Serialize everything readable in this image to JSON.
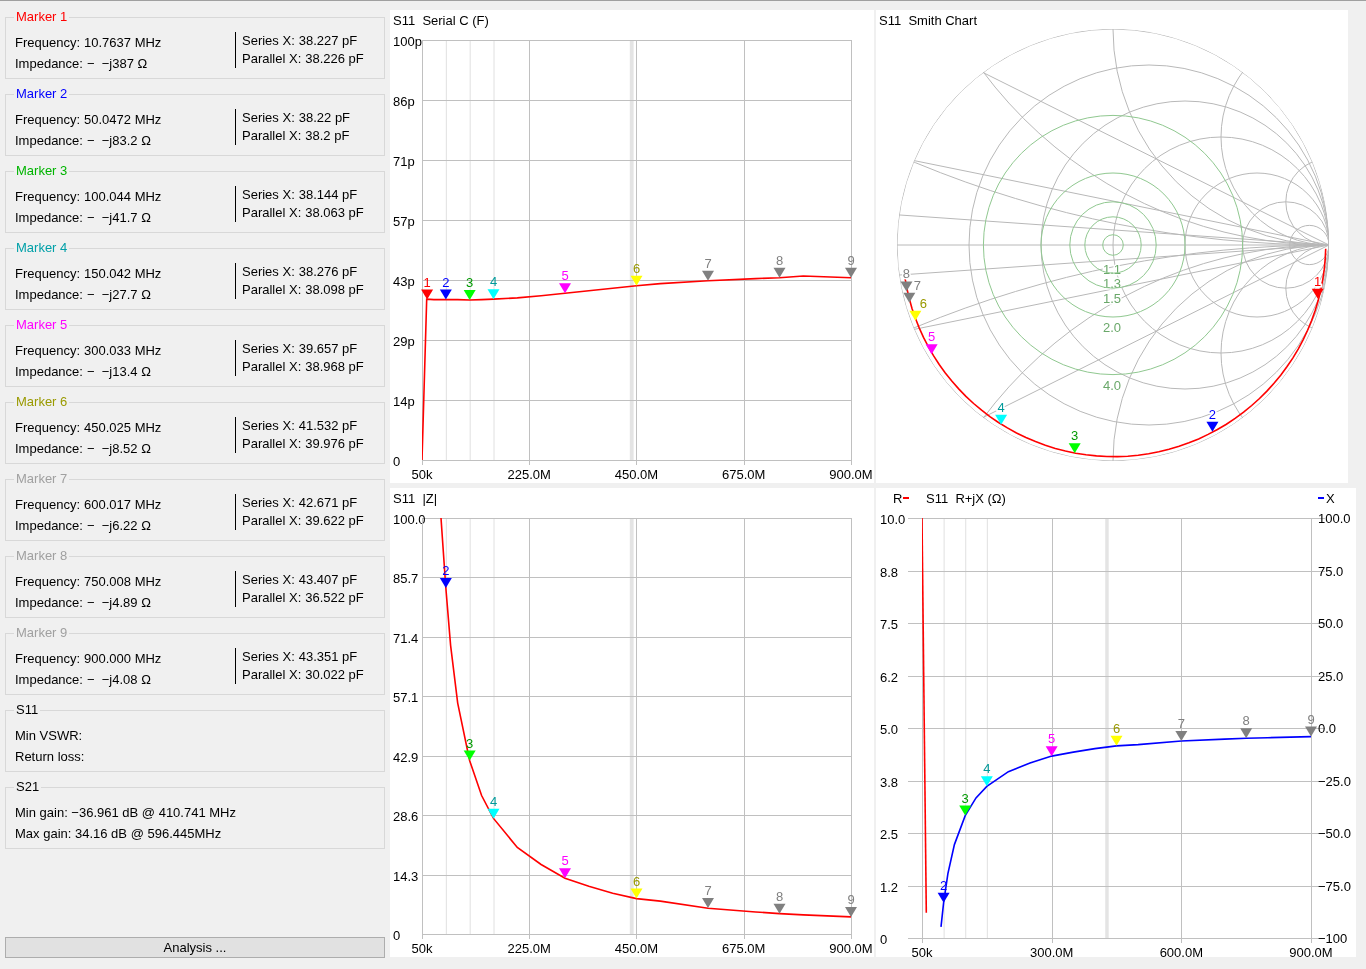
{
  "markers": [
    {
      "title": "Marker 1",
      "color": "#ff0000",
      "frequency_label": "Frequency:",
      "frequency": "10.7637 MHz",
      "impedance_label": "Impedance:",
      "impedance": "−  −j387 Ω",
      "series_label": "Series X:",
      "series_x": "38.227 pF",
      "parallel_label": "Parallel X:",
      "parallel_x": "38.226 pF"
    },
    {
      "title": "Marker 2",
      "color": "#0000ff",
      "frequency_label": "Frequency:",
      "frequency": "50.0472 MHz",
      "impedance_label": "Impedance:",
      "impedance": "−  −j83.2 Ω",
      "series_label": "Series X:",
      "series_x": "38.22 pF",
      "parallel_label": "Parallel X:",
      "parallel_x": "38.2 pF"
    },
    {
      "title": "Marker 3",
      "color": "#00b400",
      "frequency_label": "Frequency:",
      "frequency": "100.044 MHz",
      "impedance_label": "Impedance:",
      "impedance": "−  −j41.7 Ω",
      "series_label": "Series X:",
      "series_x": "38.144 pF",
      "parallel_label": "Parallel X:",
      "parallel_x": "38.063 pF"
    },
    {
      "title": "Marker 4",
      "color": "#00a0a8",
      "frequency_label": "Frequency:",
      "frequency": "150.042 MHz",
      "impedance_label": "Impedance:",
      "impedance": "−  −j27.7 Ω",
      "series_label": "Series X:",
      "series_x": "38.276 pF",
      "parallel_label": "Parallel X:",
      "parallel_x": "38.098 pF"
    },
    {
      "title": "Marker 5",
      "color": "#ff00ff",
      "frequency_label": "Frequency:",
      "frequency": "300.033 MHz",
      "impedance_label": "Impedance:",
      "impedance": "−  −j13.4 Ω",
      "series_label": "Series X:",
      "series_x": "39.657 pF",
      "parallel_label": "Parallel X:",
      "parallel_x": "38.968 pF"
    },
    {
      "title": "Marker 6",
      "color": "#9a9a00",
      "frequency_label": "Frequency:",
      "frequency": "450.025 MHz",
      "impedance_label": "Impedance:",
      "impedance": "−  −j8.52 Ω",
      "series_label": "Series X:",
      "series_x": "41.532 pF",
      "parallel_label": "Parallel X:",
      "parallel_x": "39.976 pF"
    },
    {
      "title": "Marker 7",
      "color": "#a0a0a0",
      "frequency_label": "Frequency:",
      "frequency": "600.017 MHz",
      "impedance_label": "Impedance:",
      "impedance": "−  −j6.22 Ω",
      "series_label": "Series X:",
      "series_x": "42.671 pF",
      "parallel_label": "Parallel X:",
      "parallel_x": "39.622 pF"
    },
    {
      "title": "Marker 8",
      "color": "#a0a0a0",
      "frequency_label": "Frequency:",
      "frequency": "750.008 MHz",
      "impedance_label": "Impedance:",
      "impedance": "−  −j4.89 Ω",
      "series_label": "Series X:",
      "series_x": "43.407 pF",
      "parallel_label": "Parallel X:",
      "parallel_x": "36.522 pF"
    },
    {
      "title": "Marker 9",
      "color": "#a0a0a0",
      "frequency_label": "Frequency:",
      "frequency": "900.000 MHz",
      "impedance_label": "Impedance:",
      "impedance": "−  −j4.08 Ω",
      "series_label": "Series X:",
      "series_x": "43.351 pF",
      "parallel_label": "Parallel X:",
      "parallel_x": "30.022 pF"
    }
  ],
  "s11": {
    "title": "S11",
    "rows": [
      "Min VSWR:",
      "Return loss:"
    ]
  },
  "s21": {
    "title": "S21",
    "rows": [
      "Min gain: −36.961 dB @ 410.741 MHz",
      "Max gain: 34.16 dB @ 596.445MHz"
    ]
  },
  "analysis_button": "Analysis ...",
  "charts": [
    {
      "kind": "line",
      "markers": [
        {
          "color": "#ff0000"
        },
        {
          "color": "#0000ff"
        },
        {
          "color": "#00ff00"
        },
        {
          "color": "#00ffff"
        },
        {
          "color": "#ff00ff"
        },
        {
          "color": "#ffff00"
        },
        {
          "color": "#808080"
        },
        {
          "color": "#808080"
        },
        {
          "color": "#808080"
        }
      ],
      "chart_data": {
        "type": "line",
        "grid": true,
        "title": "S11  Serial C (F)",
        "bands": [
          {
            "axis": "x",
            "from": 436000000,
            "to": 444000000
          }
        ],
        "x": [
          50000,
          10000000,
          25000000,
          40000000,
          50000000,
          60000000,
          75000000,
          100000000,
          125000000,
          150000000,
          200000000,
          250000000,
          300000000,
          350000000,
          400000000,
          450000000,
          500000000,
          600000000,
          700000000,
          750000000,
          800000000,
          900000000
        ],
        "series": [
          {
            "color": "#ff0000",
            "values": [
              0,
              38.3,
              38.2,
              38.2,
              38.2,
              38.2,
              38.2,
              38.1,
              38.2,
              38.3,
              38.6,
              39.1,
              39.7,
              40.3,
              40.9,
              41.5,
              42.0,
              42.7,
              43.2,
              43.4,
              43.8,
              43.4
            ]
          }
        ],
        "xlim": [
          50000,
          900000000
        ],
        "ylim": [
          0,
          100
        ],
        "xticks": [
          {
            "value": 50000,
            "label": "50k"
          },
          {
            "value": 225000000,
            "label": "225.0M"
          },
          {
            "value": 450000000,
            "label": "450.0M"
          },
          {
            "value": 675000000,
            "label": "675.0M"
          },
          {
            "value": 900000000,
            "label": "900.0M"
          }
        ],
        "yticks": [
          {
            "value": 0,
            "label": "0"
          },
          {
            "value": 14.3,
            "label": "14p"
          },
          {
            "value": 28.6,
            "label": "29p"
          },
          {
            "value": 42.9,
            "label": "43p"
          },
          {
            "value": 57.1,
            "label": "57p"
          },
          {
            "value": 71.4,
            "label": "71p"
          },
          {
            "value": 85.7,
            "label": "86p"
          },
          {
            "value": 100,
            "label": "100p"
          }
        ],
        "annotations": [
          {
            "x": 10763700,
            "y": 38.2,
            "text": "1"
          },
          {
            "x": 50047200,
            "y": 38.2,
            "text": "2"
          },
          {
            "x": 100044000,
            "y": 38.1,
            "text": "3"
          },
          {
            "x": 150042000,
            "y": 38.3,
            "text": "4"
          },
          {
            "x": 300033000,
            "y": 39.7,
            "text": "5"
          },
          {
            "x": 450025000,
            "y": 41.5,
            "text": "6"
          },
          {
            "x": 600017000,
            "y": 42.7,
            "text": "7"
          },
          {
            "x": 750008000,
            "y": 43.4,
            "text": "8"
          },
          {
            "x": 900000000,
            "y": 43.4,
            "text": "9"
          }
        ]
      }
    },
    {
      "kind": "smith",
      "title": "S11  Smith Chart",
      "vswr_labels": [
        "1.1",
        "1.3",
        "1.5",
        "2.0",
        "4.0"
      ],
      "markers": [
        {
          "label": "1",
          "color": "#ff0000"
        },
        {
          "label": "2",
          "color": "#0000ff"
        },
        {
          "label": "3",
          "color": "#00ff00"
        },
        {
          "label": "4",
          "color": "#00ffff"
        },
        {
          "label": "5",
          "color": "#ff00ff"
        },
        {
          "label": "6",
          "color": "#ffff00"
        },
        {
          "label": "7",
          "color": "#808080"
        },
        {
          "label": "8",
          "color": "#808080"
        }
      ]
    },
    {
      "kind": "line",
      "markers": [
        {
          "color": "#0000ff"
        },
        {
          "color": "#00ff00"
        },
        {
          "color": "#00ffff"
        },
        {
          "color": "#ff00ff"
        },
        {
          "color": "#ffff00"
        },
        {
          "color": "#808080"
        },
        {
          "color": "#808080"
        },
        {
          "color": "#808080"
        }
      ],
      "chart_data": {
        "type": "line",
        "grid": true,
        "title": "S11  |Z|",
        "bands": [
          {
            "axis": "x",
            "from": 436000000,
            "to": 444000000
          }
        ],
        "x": [
          40000000,
          50000000,
          60000000,
          75000000,
          100000000,
          125000000,
          150000000,
          200000000,
          250000000,
          300000000,
          350000000,
          400000000,
          450000000,
          500000000,
          600000000,
          700000000,
          750000000,
          800000000,
          900000000
        ],
        "series": [
          {
            "color": "#ff0000",
            "values": [
              100,
              83.3,
              69.4,
              55.5,
              41.7,
              33.3,
              27.8,
              20.8,
              16.7,
              13.4,
              11.5,
              9.8,
              8.5,
              7.9,
              6.2,
              5.3,
              4.9,
              4.6,
              4.1
            ]
          }
        ],
        "xlim": [
          50000,
          900000000
        ],
        "ylim": [
          0,
          100
        ],
        "xticks": [
          {
            "value": 50000,
            "label": "50k"
          },
          {
            "value": 225000000,
            "label": "225.0M"
          },
          {
            "value": 450000000,
            "label": "450.0M"
          },
          {
            "value": 675000000,
            "label": "675.0M"
          },
          {
            "value": 900000000,
            "label": "900.0M"
          }
        ],
        "yticks": [
          {
            "value": 0,
            "label": "0"
          },
          {
            "value": 14.3,
            "label": "14.3"
          },
          {
            "value": 28.6,
            "label": "28.6"
          },
          {
            "value": 42.9,
            "label": "42.9"
          },
          {
            "value": 57.1,
            "label": "57.1"
          },
          {
            "value": 71.4,
            "label": "71.4"
          },
          {
            "value": 85.7,
            "label": "85.7"
          },
          {
            "value": 100,
            "label": "100.0"
          }
        ],
        "annotations": [
          {
            "x": 50047200,
            "y": 83.2,
            "text": "2"
          },
          {
            "x": 100044000,
            "y": 41.7,
            "text": "3"
          },
          {
            "x": 150042000,
            "y": 27.7,
            "text": "4"
          },
          {
            "x": 300033000,
            "y": 13.4,
            "text": "5"
          },
          {
            "x": 450025000,
            "y": 8.52,
            "text": "6"
          },
          {
            "x": 600017000,
            "y": 6.22,
            "text": "7"
          },
          {
            "x": 750008000,
            "y": 4.89,
            "text": "8"
          },
          {
            "x": 900000000,
            "y": 4.08,
            "text": "9"
          }
        ]
      }
    },
    {
      "kind": "dual",
      "markers": [
        {
          "label": "2",
          "color": "#0000ff"
        },
        {
          "label": "3",
          "color": "#00ff00"
        },
        {
          "label": "4",
          "color": "#00ffff"
        },
        {
          "label": "5",
          "color": "#ff00ff"
        },
        {
          "label": "6",
          "color": "#ffff00"
        },
        {
          "label": "7",
          "color": "#808080"
        },
        {
          "label": "8",
          "color": "#808080"
        },
        {
          "label": "9",
          "color": "#808080"
        }
      ],
      "chart_data": {
        "type": "line",
        "grid": true,
        "title": "S11  R+jX (Ω)",
        "bands": [
          {
            "axis": "x",
            "from": 424000000,
            "to": 432000000
          }
        ],
        "x": [
          50000,
          10000000,
          25000000,
          40000000,
          44000000,
          50000000,
          60000000,
          75000000,
          100000000,
          125000000,
          150000000,
          200000000,
          250000000,
          300000000,
          350000000,
          400000000,
          450000000,
          500000000,
          600000000,
          700000000,
          750000000,
          800000000,
          900000000
        ],
        "series": [
          {
            "name": "R",
            "color": "#ff0000",
            "values": [
              10,
              0.6,
              null,
              null,
              null,
              null,
              null,
              null,
              null,
              null,
              null,
              null,
              null,
              null,
              null,
              null,
              null,
              null,
              null,
              null,
              null,
              null,
              null
            ]
          },
          {
            "name": "X",
            "color": "#0000ff",
            "axis": "y2",
            "values": [
              null,
              null,
              null,
              null,
              -94.7,
              -83.3,
              -69.4,
              -55.5,
              -41.7,
              -33.3,
              -27.8,
              -20.8,
              -16.7,
              -13.4,
              -11.5,
              -9.8,
              -8.5,
              -7.9,
              -6.2,
              -5.3,
              -4.9,
              -4.6,
              -4.1
            ]
          }
        ],
        "xlim": [
          50000,
          900000000
        ],
        "ylim": [
          0,
          10
        ],
        "y2lim": [
          -100,
          100
        ],
        "y2ticks": [
          {
            "value": -100,
            "label": "−100"
          },
          {
            "value": -75,
            "label": "−75.0"
          },
          {
            "value": -50,
            "label": "−50.0"
          },
          {
            "value": -25,
            "label": "−25.0"
          },
          {
            "value": 0,
            "label": "0.0"
          },
          {
            "value": 25,
            "label": "25.0"
          },
          {
            "value": 50,
            "label": "50.0"
          },
          {
            "value": 75,
            "label": "75.0"
          },
          {
            "value": 100,
            "label": "100.0"
          }
        ],
        "xticks": [
          {
            "value": 50000,
            "label": "50k"
          },
          {
            "value": 300000000,
            "label": "300.0M"
          },
          {
            "value": 600000000,
            "label": "600.0M"
          },
          {
            "value": 900000000,
            "label": "900.0M"
          }
        ],
        "yticks": [
          {
            "value": 0,
            "label": "0"
          },
          {
            "value": 1.25,
            "label": "1.2"
          },
          {
            "value": 2.5,
            "label": "2.5"
          },
          {
            "value": 3.75,
            "label": "3.8"
          },
          {
            "value": 5,
            "label": "5.0"
          },
          {
            "value": 6.25,
            "label": "6.2"
          },
          {
            "value": 7.5,
            "label": "7.5"
          },
          {
            "value": 8.75,
            "label": "8.8"
          },
          {
            "value": 10,
            "label": "10.0"
          }
        ]
      }
    }
  ]
}
